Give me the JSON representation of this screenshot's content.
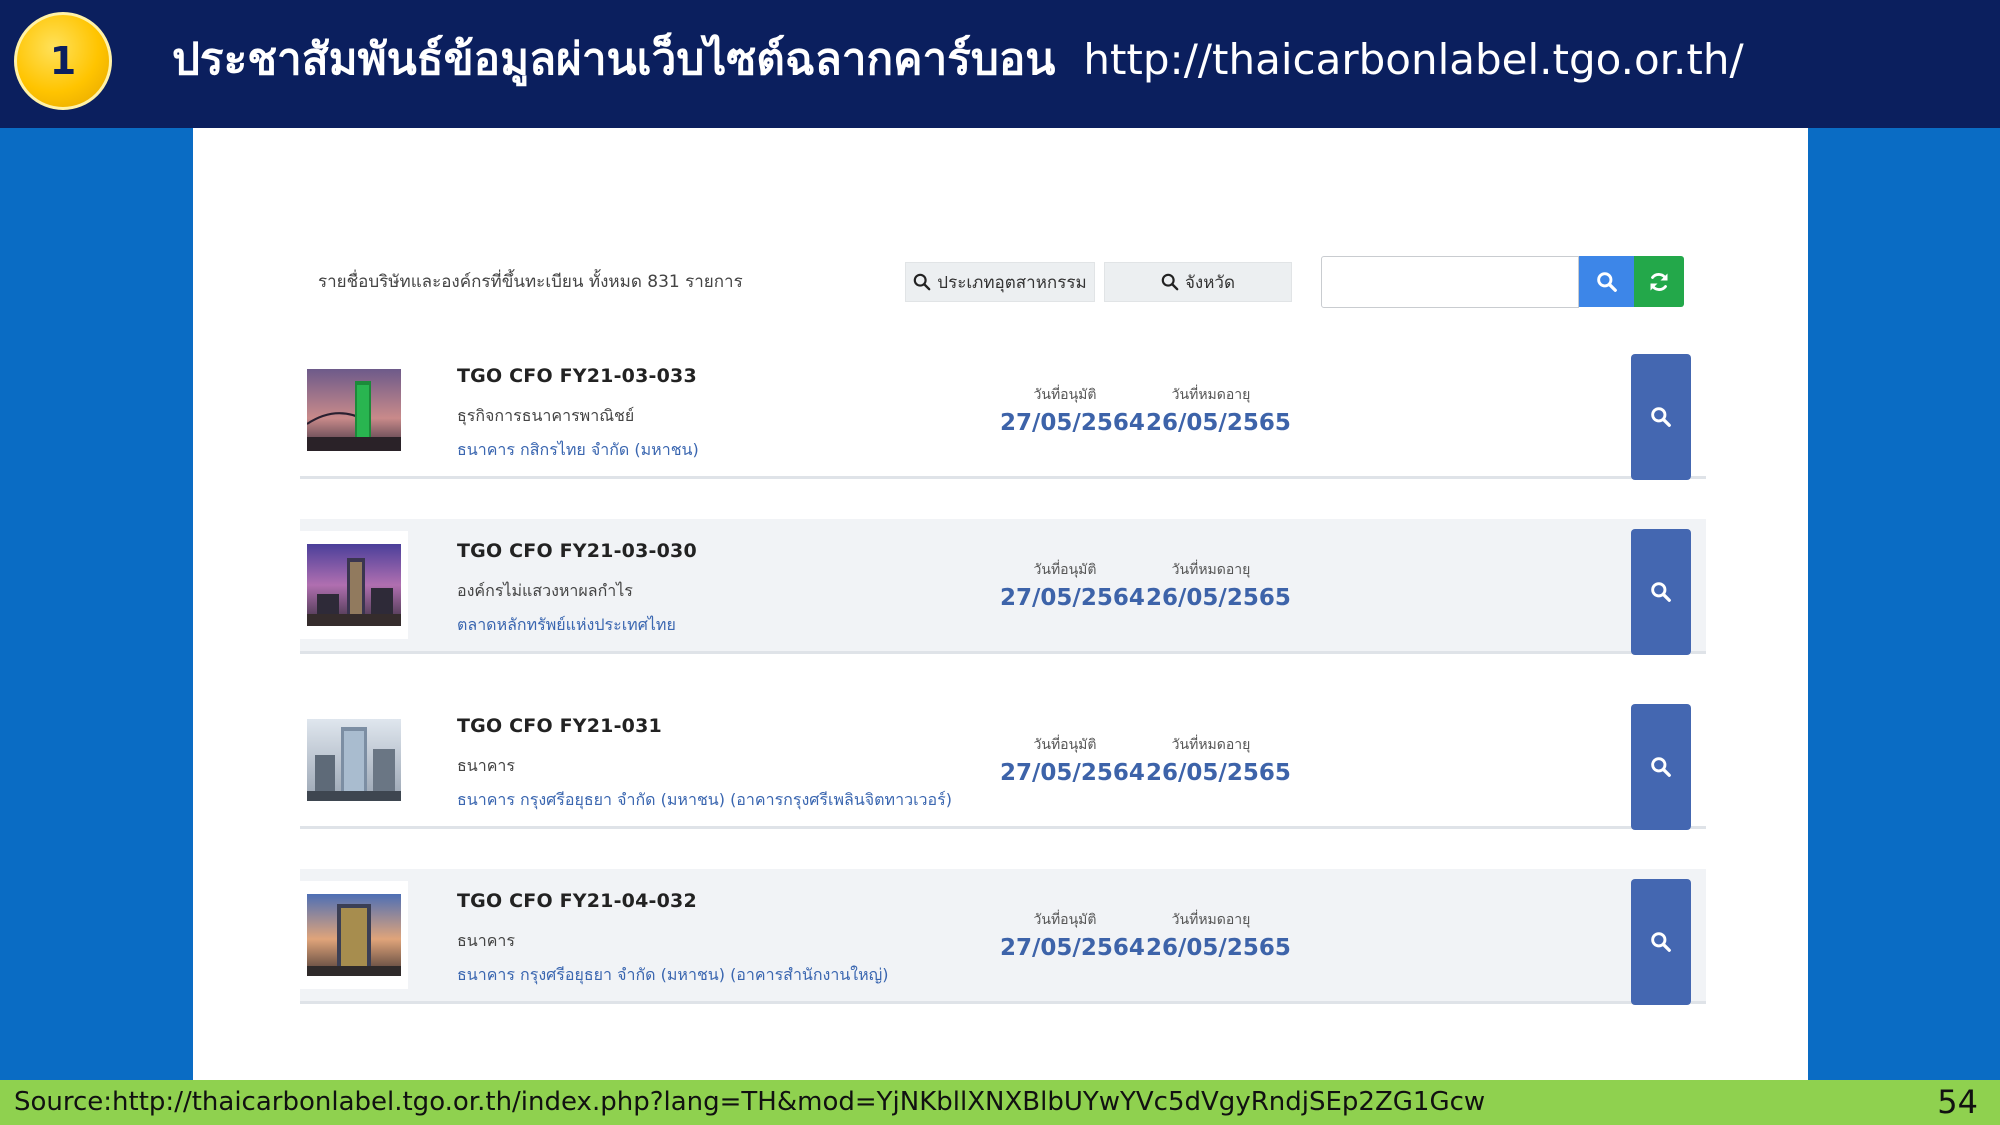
{
  "header": {
    "badge_number": "1",
    "title_th": "ประชาสัมพันธ์ข้อมูลผ่านเว็บไซต์ฉลากคาร์บอน",
    "title_url": "http://thaicarbonlabel.tgo.or.th/"
  },
  "toolbar": {
    "summary": "รายชื่อบริษัทและองค์กรที่ขึ้นทะเบียน ทั้งหมด 831 รายการ",
    "filter_industry": "ประเภทอุตสาหกรรม",
    "filter_province": "จังหวัด",
    "search_placeholder": ""
  },
  "labels": {
    "approved": "วันที่อนุมัติ",
    "expiry": "วันที่หมดอายุ"
  },
  "rows": [
    {
      "code": "TGO CFO FY21-03-033",
      "type": "ธุรกิจการธนาคารพาณิชย์",
      "org": "ธนาคาร กสิกรไทย จำกัด (มหาชน)",
      "approved_date": "27/05/2564",
      "expiry_date": "26/05/2565"
    },
    {
      "code": "TGO CFO FY21-03-030",
      "type": "องค์กรไม่แสวงหาผลกำไร",
      "org": "ตลาดหลักทรัพย์แห่งประเทศไทย",
      "approved_date": "27/05/2564",
      "expiry_date": "26/05/2565"
    },
    {
      "code": "TGO CFO FY21-031",
      "type": "ธนาคาร",
      "org": "ธนาคาร กรุงศรีอยุธยา จำกัด (มหาชน) (อาคารกรุงศรีเพลินจิตทาวเวอร์)",
      "approved_date": "27/05/2564",
      "expiry_date": "26/05/2565"
    },
    {
      "code": "TGO CFO FY21-04-032",
      "type": "ธนาคาร",
      "org": "ธนาคาร กรุงศรีอยุธยา จำกัด (มหาชน) (อาคารสำนักงานใหญ่)",
      "approved_date": "27/05/2564",
      "expiry_date": "26/05/2565"
    }
  ],
  "footer": {
    "source": "Source:http://thaicarbonlabel.tgo.or.th/index.php?lang=TH&mod=YjNKbllXNXBlbUYwYVc5dVgyRndjSEp2ZG1Gcw",
    "page_number": "54"
  },
  "colors": {
    "header_bg": "#0b1f5e",
    "page_bg": "#0a6cc4",
    "footer_bg": "#8fd14f",
    "view_button": "#4467b1",
    "search_button": "#3d86e8",
    "refresh_button": "#23a84a",
    "date_text": "#3d63a9"
  }
}
